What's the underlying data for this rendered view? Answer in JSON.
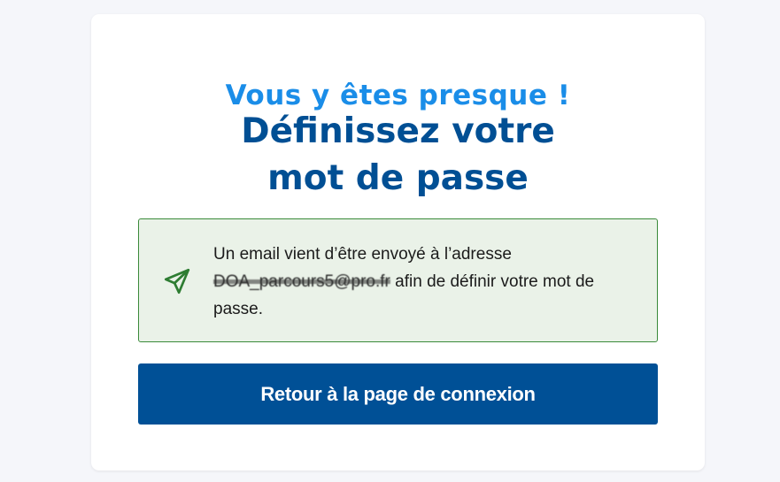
{
  "card": {
    "eyebrow": "Vous y êtes presque !",
    "title_line1": "Définissez votre",
    "title_line2": "mot de passe"
  },
  "notice": {
    "icon": "paper-plane-icon",
    "text_before": "Un email vient d’être envoyé à l’adresse ",
    "email": "DOA_parcours5@pro.fr",
    "text_after": " afin de définir votre mot de passe."
  },
  "actions": {
    "back_label": "Retour à la page de connexion"
  },
  "colors": {
    "accent": "#1a8de8",
    "title": "#004f94",
    "button": "#005096",
    "notice_bg": "#eaf2e8",
    "notice_border": "#3a8a3a",
    "page_bg": "#f5f6fa"
  }
}
